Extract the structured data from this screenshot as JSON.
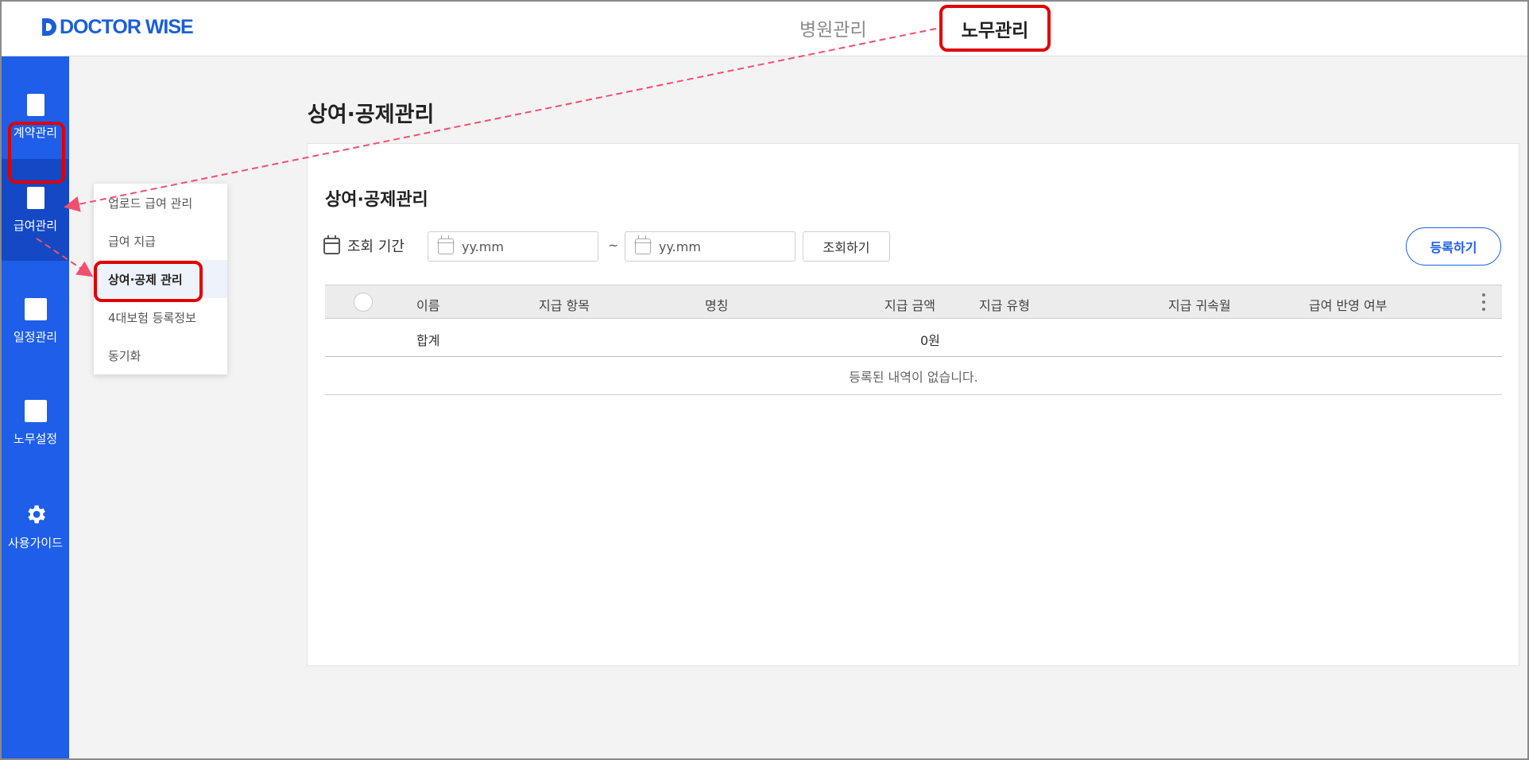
{
  "topbar": {
    "logo_text": "DOCTOR WISE",
    "tabs": [
      {
        "label": "병원관리"
      },
      {
        "label": "노무관리"
      }
    ]
  },
  "sidebar": {
    "items": [
      {
        "label": "계약관리",
        "icon": "document-icon"
      },
      {
        "label": "급여관리",
        "icon": "document-icon"
      },
      {
        "label": "일정관리",
        "icon": "calendar-icon"
      },
      {
        "label": "노무설정",
        "icon": "settings-square-icon"
      },
      {
        "label": "사용가이드",
        "icon": "gear-icon"
      }
    ]
  },
  "submenu": {
    "items": [
      {
        "label": "업로드 급여 관리"
      },
      {
        "label": "급여 지급"
      },
      {
        "label": "상여·공제 관리"
      },
      {
        "label": "4대보험 등록정보"
      },
      {
        "label": "동기화"
      }
    ]
  },
  "page": {
    "title": "상여·공제관리",
    "card_title": "상여·공제관리"
  },
  "filter": {
    "label": "조회 기간",
    "from_placeholder": "yy.mm",
    "to_placeholder": "yy.mm",
    "separator": "~",
    "search_label": "조회하기",
    "register_label": "등록하기"
  },
  "table": {
    "columns": [
      "이름",
      "지급 항목",
      "명칭",
      "지급 금액",
      "지급 유형",
      "지급 귀속월",
      "급여 반영 여부"
    ],
    "total_row": {
      "name": "합계",
      "amount": "0원"
    },
    "empty_message": "등록된 내역이 없습니다."
  },
  "colors": {
    "primary": "#1e5ee8",
    "highlight": "#e00000",
    "arrow": "#f0506e"
  }
}
